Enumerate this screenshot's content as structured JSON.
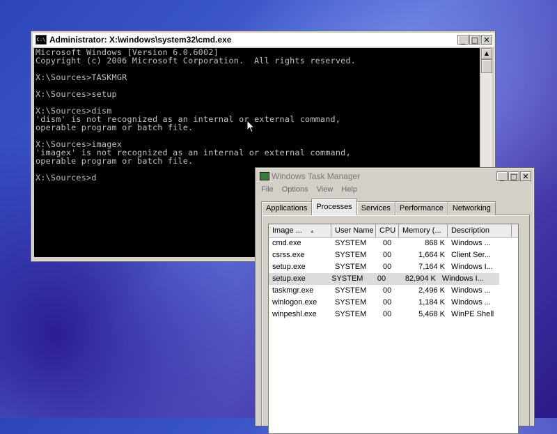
{
  "cmd": {
    "title": "Administrator: X:\\windows\\system32\\cmd.exe",
    "icon_text": "C:\\",
    "minimize": "_",
    "maximize": "□",
    "close": "✕",
    "console_text": "Microsoft Windows [Version 6.0.6002]\nCopyright (c) 2006 Microsoft Corporation.  All rights reserved.\n\nX:\\Sources>TASKMGR\n\nX:\\Sources>setup\n\nX:\\Sources>dism\n'dism' is not recognized as an internal or external command,\noperable program or batch file.\n\nX:\\Sources>imagex\n'imagex' is not recognized as an internal or external command,\noperable program or batch file.\n\nX:\\Sources>d",
    "scroll_up": "▲",
    "scroll_thumb_position": 0
  },
  "taskmgr": {
    "title": "Windows Task Manager",
    "minimize": "_",
    "maximize": "□",
    "close": "✕",
    "menu": [
      "File",
      "Options",
      "View",
      "Help"
    ],
    "tabs": [
      {
        "label": "Applications",
        "active": false
      },
      {
        "label": "Processes",
        "active": true
      },
      {
        "label": "Services",
        "active": false
      },
      {
        "label": "Performance",
        "active": false
      },
      {
        "label": "Networking",
        "active": false
      }
    ],
    "columns": [
      "Image ...",
      "User Name",
      "CPU",
      "Memory (...",
      "Description"
    ],
    "sort_indicator": "▲",
    "rows": [
      {
        "image": "cmd.exe",
        "user": "SYSTEM",
        "cpu": "00",
        "memory": "868 K",
        "description": "Windows ...",
        "selected": false
      },
      {
        "image": "csrss.exe",
        "user": "SYSTEM",
        "cpu": "00",
        "memory": "1,664 K",
        "description": "Client Ser...",
        "selected": false
      },
      {
        "image": "setup.exe",
        "user": "SYSTEM",
        "cpu": "00",
        "memory": "7,164 K",
        "description": "Windows I...",
        "selected": false
      },
      {
        "image": "setup.exe",
        "user": "SYSTEM",
        "cpu": "00",
        "memory": "82,904 K",
        "description": "Windows I...",
        "selected": true
      },
      {
        "image": "taskmgr.exe",
        "user": "SYSTEM",
        "cpu": "00",
        "memory": "2,496 K",
        "description": "Windows ...",
        "selected": false
      },
      {
        "image": "winlogon.exe",
        "user": "SYSTEM",
        "cpu": "00",
        "memory": "1,184 K",
        "description": "Windows ...",
        "selected": false
      },
      {
        "image": "winpeshl.exe",
        "user": "SYSTEM",
        "cpu": "00",
        "memory": "5,468 K",
        "description": "WinPE Shell",
        "selected": false
      }
    ]
  }
}
